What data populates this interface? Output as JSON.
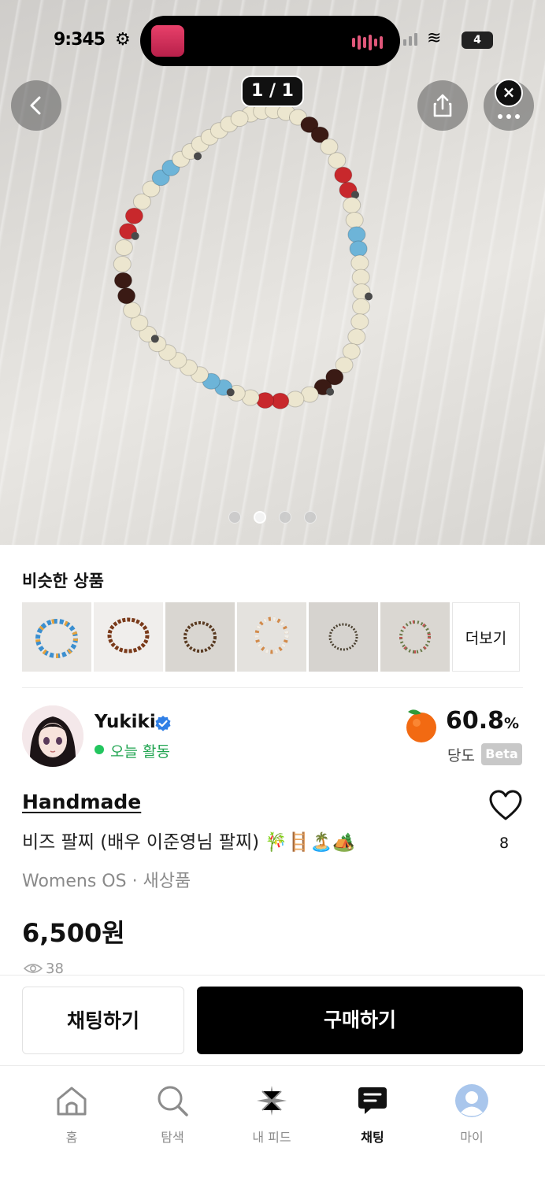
{
  "status_bar": {
    "time": "9:345",
    "battery": "4"
  },
  "gallery": {
    "counter": "1 / 1",
    "dots": 4,
    "active_dot": 1
  },
  "similar": {
    "title": "비슷한 상품",
    "more_label": "더보기"
  },
  "seller": {
    "name": "Yukiki",
    "activity": "오늘 활동",
    "sweetness_value": "60.8",
    "sweetness_unit": "%",
    "sweetness_label": "당도",
    "beta_label": "Beta"
  },
  "product": {
    "brand": "Handmade",
    "title": "비즈 팔찌 (배우 이준영님 팔찌) 🎋🪜🏝️🏕️",
    "meta": "Womens OS · 새상품",
    "price": "6,500원",
    "likes": "8",
    "views": "38"
  },
  "actions": {
    "chat": "채팅하기",
    "buy": "구매하기"
  },
  "tabs": [
    {
      "label": "홈",
      "icon": "home-icon"
    },
    {
      "label": "탐색",
      "icon": "search-icon"
    },
    {
      "label": "내 피드",
      "icon": "sparkle-icon"
    },
    {
      "label": "채팅",
      "icon": "chat-icon"
    },
    {
      "label": "마이",
      "icon": "profile-icon"
    }
  ],
  "colors": {
    "accent_green": "#22a552",
    "buy_button": "#000000",
    "inactive_tab": "#8c8c8c"
  }
}
